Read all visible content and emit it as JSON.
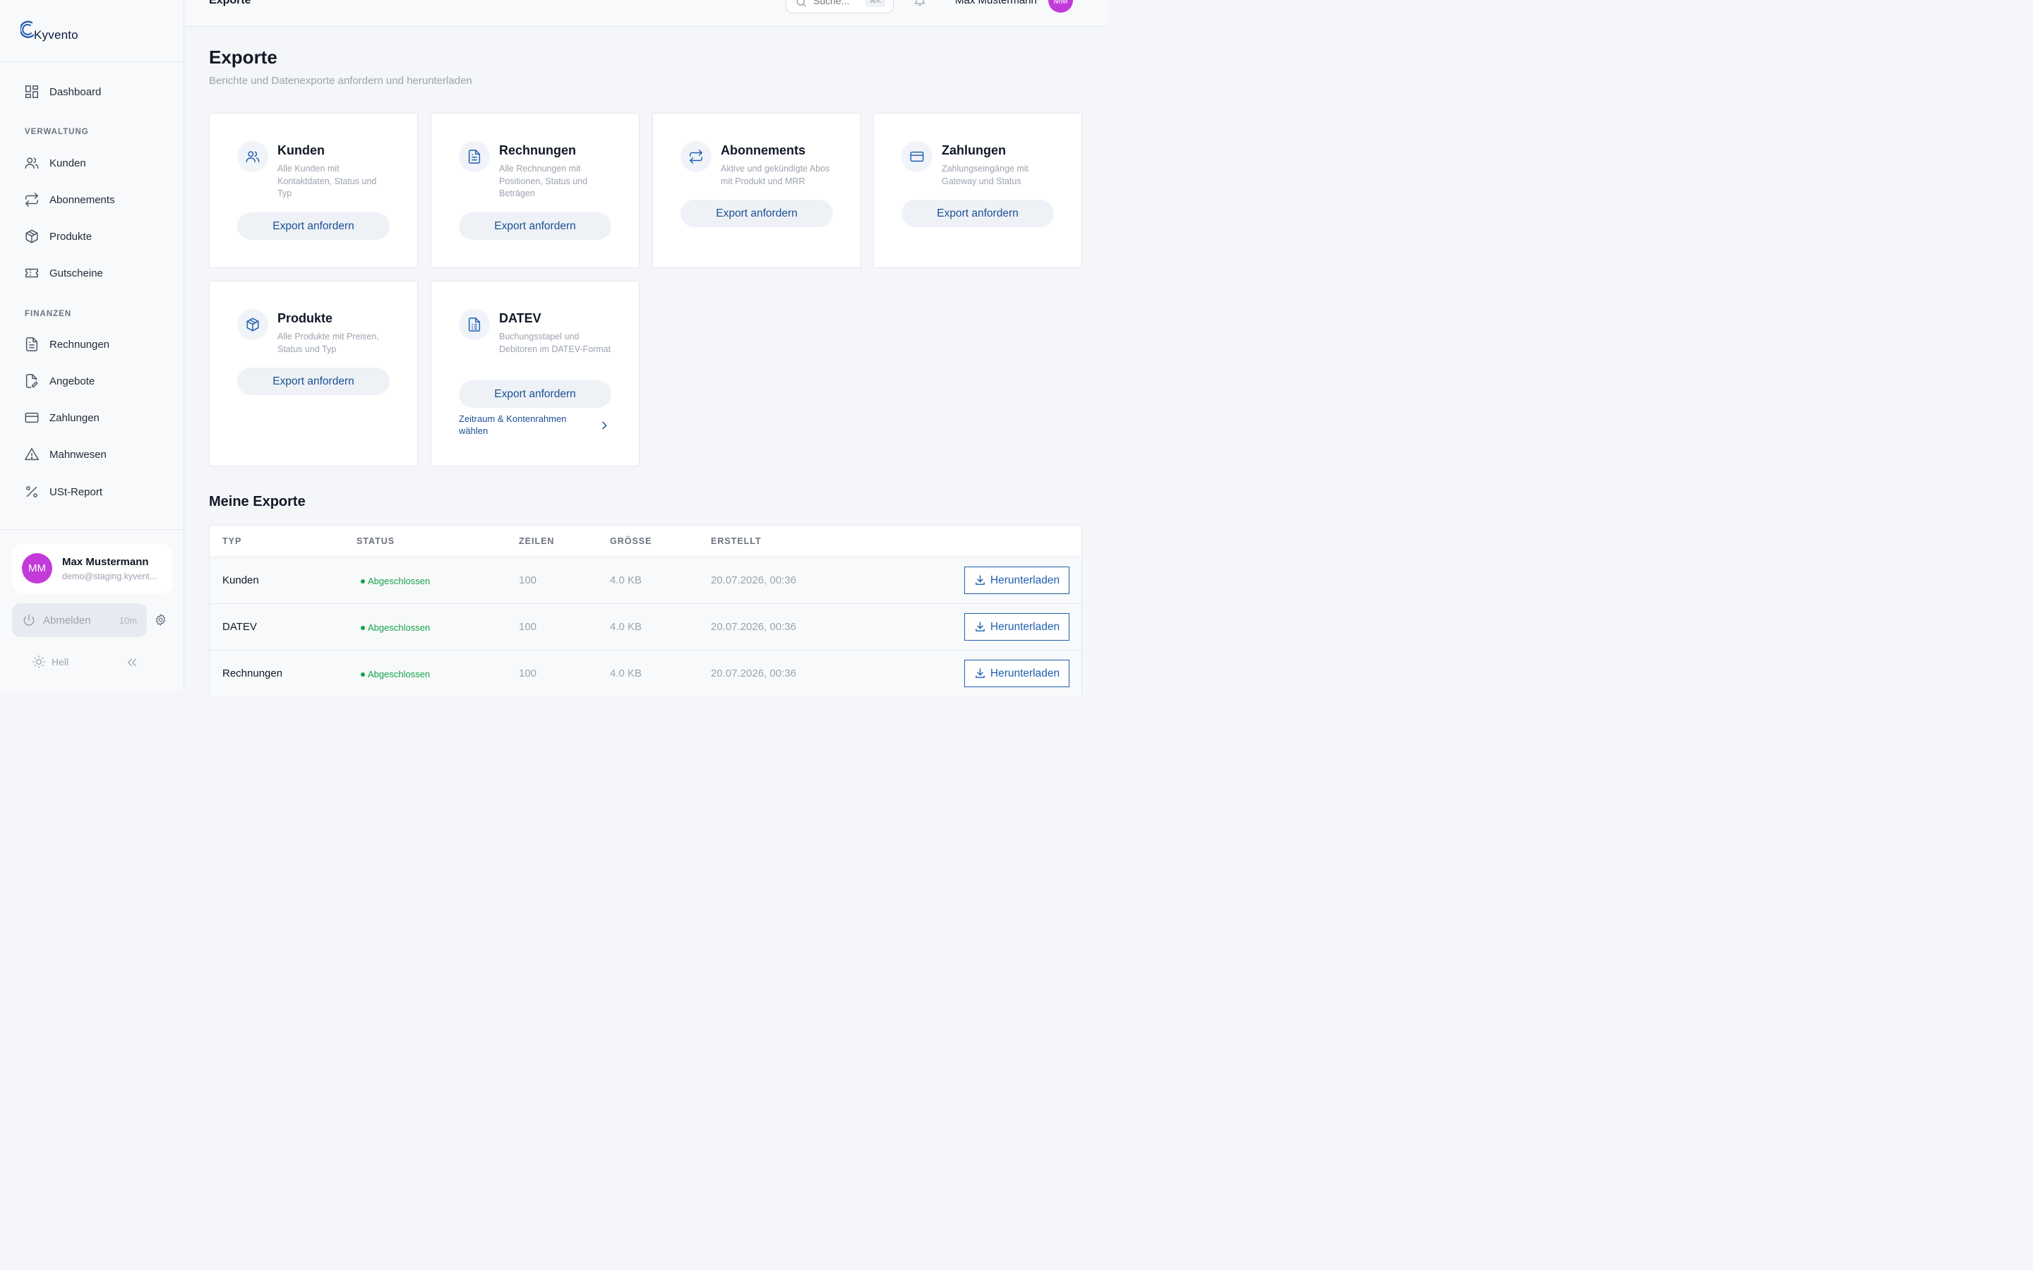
{
  "brand": {
    "name": "Kyvento"
  },
  "topbar": {
    "title": "Exporte",
    "search_placeholder": "Suche...",
    "search_shortcut": "⌘K",
    "user_name": "Max Mustermann",
    "user_initials": "MM"
  },
  "sidebar": {
    "dashboard": "Dashboard",
    "section_admin": "VERWALTUNG",
    "kunden": "Kunden",
    "abonnements": "Abonnements",
    "produkte": "Produkte",
    "gutscheine": "Gutscheine",
    "section_finance": "FINANZEN",
    "rechnungen": "Rechnungen",
    "angebote": "Angebote",
    "zahlungen": "Zahlungen",
    "mahnwesen": "Mahnwesen",
    "ust_report": "USt-Report"
  },
  "footer": {
    "initials": "MM",
    "name": "Max Mustermann",
    "email": "demo@staging.kyvent...",
    "logout": "Abmelden",
    "session_time": "10m",
    "theme": "Hell"
  },
  "page": {
    "title": "Exporte",
    "subtitle": "Berichte und Datenexporte anfordern und herunterladen"
  },
  "cards": [
    {
      "title": "Kunden",
      "desc": "Alle Kunden mit Kontaktdaten, Status und Typ",
      "button": "Export anfordern",
      "icon": "users-icon"
    },
    {
      "title": "Rechnungen",
      "desc": "Alle Rechnungen mit Positionen, Status und Beträgen",
      "button": "Export anfordern",
      "icon": "document-icon"
    },
    {
      "title": "Abonnements",
      "desc": "Aktive und gekündigte Abos mit Produkt und MRR",
      "button": "Export anfordern",
      "icon": "repeat-icon"
    },
    {
      "title": "Zahlungen",
      "desc": "Zahlungseingänge mit Gateway und Status",
      "button": "Export anfordern",
      "icon": "credit-card-icon"
    },
    {
      "title": "Produkte",
      "desc": "Alle Produkte mit Preisen, Status und Typ",
      "button": "Export anfordern",
      "icon": "package-icon"
    },
    {
      "title": "DATEV",
      "desc": "Buchungsstapel und Debitoren im DATEV-Format",
      "button": "Export anfordern",
      "icon": "spreadsheet-icon",
      "link": "Zeitraum & Kontenrahmen wählen"
    }
  ],
  "exports": {
    "title": "Meine Exporte",
    "headers": [
      "TYP",
      "STATUS",
      "ZEILEN",
      "GRÖSSE",
      "ERSTELLT"
    ],
    "rows": [
      {
        "type": "Kunden",
        "status": "Abgeschlossen",
        "rows": "100",
        "size": "4.0 KB",
        "created": "20.07.2026, 00:36",
        "action": "Herunterladen"
      },
      {
        "type": "DATEV",
        "status": "Abgeschlossen",
        "rows": "100",
        "size": "4.0 KB",
        "created": "20.07.2026, 00:36",
        "action": "Herunterladen"
      },
      {
        "type": "Rechnungen",
        "status": "Abgeschlossen",
        "rows": "100",
        "size": "4.0 KB",
        "created": "20.07.2026, 00:36",
        "action": "Herunterladen"
      }
    ]
  },
  "colors": {
    "accent": "#1f5fae",
    "avatar": "#c23bd8",
    "success": "#16a34a"
  }
}
